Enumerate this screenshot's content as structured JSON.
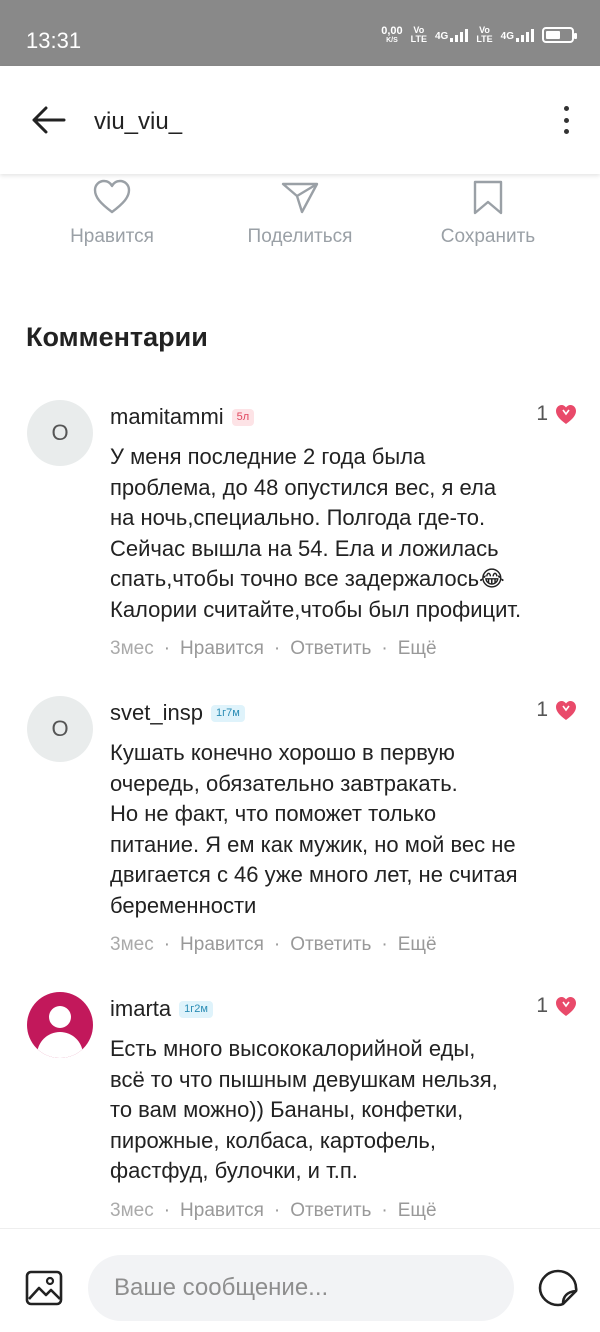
{
  "status_bar": {
    "time": "13:31",
    "net_speed_value": "0,00",
    "net_speed_unit": "K/S",
    "volte_top": "Vo",
    "volte_bottom": "LTE",
    "network_type": "4G",
    "icons": [
      "signal-icon",
      "battery-icon"
    ]
  },
  "header": {
    "title": "viu_viu_",
    "back_icon": "arrow-left-icon",
    "menu_icon": "more-vertical-icon"
  },
  "post_actions": {
    "like_label": "Нравится",
    "share_label": "Поделиться",
    "save_label": "Сохранить"
  },
  "comments_section": {
    "title": "Комментарии",
    "items": [
      {
        "avatar_letter": "O",
        "name": "mamitammi",
        "badge": "5л",
        "likes": "1",
        "text": "У меня последние 2 года была\nпроблема, до 48 опустился вес, я ела\nна ночь,специально. Полгода где-то.\nСейчас вышла на 54. Ела и ложилась\nспать,чтобы точно все задержалось😂\nКалории считайте,чтобы был профицит.",
        "time": "3мес",
        "like_action": "Нравится",
        "reply_action": "Ответить",
        "more_action": "Ещё"
      },
      {
        "avatar_letter": "O",
        "name": "svet_insp",
        "badge": "1г7м",
        "likes": "1",
        "text": "Кушать конечно хорошо в первую\nочередь, обязательно завтракать.\nНо не факт, что поможет только\nпитание. Я ем как мужик, но мой вес не\nдвигается с 46 уже много лет, не считая\nбеременности",
        "time": "3мес",
        "like_action": "Нравится",
        "reply_action": "Ответить",
        "more_action": "Ещё"
      },
      {
        "avatar_letter": "",
        "name": "imarta",
        "badge": "1г2м",
        "likes": "1",
        "text": "Есть много высококалорийной еды,\nвсё то что пышным девушкам нельзя,\nто вам можно)) Бананы, конфетки,\nпирожные, колбаса, картофель,\nфастфуд, булочки,  и т.п.",
        "time": "3мес",
        "like_action": "Нравится",
        "reply_action": "Ответить",
        "more_action": "Ещё"
      }
    ]
  },
  "composer": {
    "placeholder": "Ваше сообщение...",
    "image_icon": "image-icon",
    "sticker_icon": "sticker-icon"
  },
  "colors": {
    "status_bar_bg": "#898989",
    "accent_pink": "#e94a6a",
    "muted_text": "#9aa0a6",
    "avatar_user_bg": "#c2185b"
  }
}
